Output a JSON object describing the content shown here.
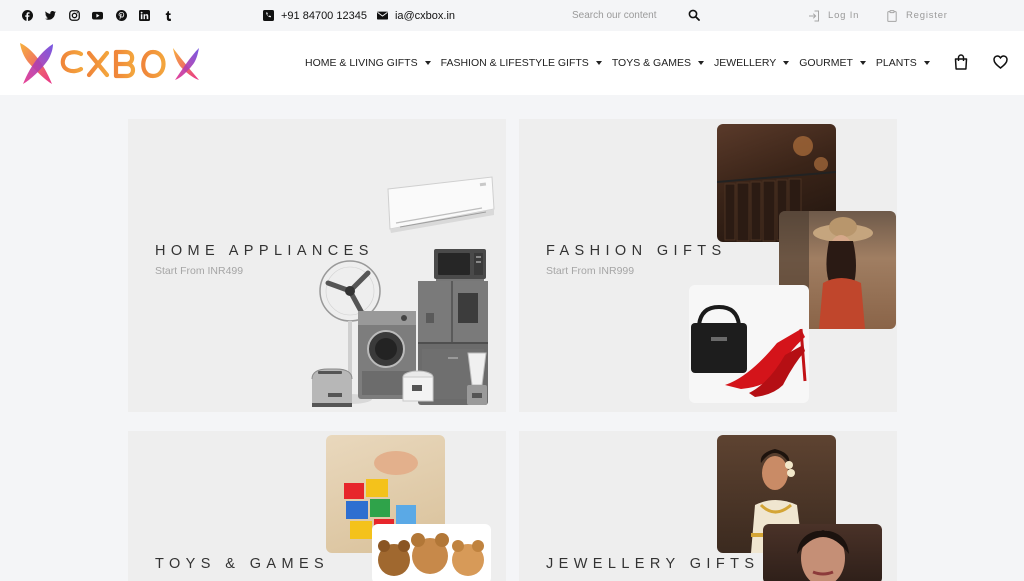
{
  "topbar": {
    "social_icons": [
      "facebook-icon",
      "twitter-icon",
      "instagram-icon",
      "youtube-icon",
      "pinterest-icon",
      "linkedin-icon",
      "tumblr-icon"
    ],
    "phone": "+91 84700 12345",
    "email": "ia@cxbox.in",
    "search_placeholder": "Search our content",
    "login_label": "Log In",
    "register_label": "Register"
  },
  "header": {
    "logo_text": "CXBOX",
    "nav": [
      {
        "label": "HOME & LIVING GIFTS"
      },
      {
        "label": "FASHION & LIFESTYLE GIFTS"
      },
      {
        "label": "TOYS & GAMES"
      },
      {
        "label": "JEWELLERY"
      },
      {
        "label": "GOURMET"
      },
      {
        "label": "PLANTS"
      }
    ]
  },
  "categories": [
    {
      "title": "HOME APPLIANCES",
      "subtitle": "Start From INR499"
    },
    {
      "title": "FASHION GIFTS",
      "subtitle": "Start From INR999"
    },
    {
      "title": "TOYS & GAMES",
      "subtitle": ""
    },
    {
      "title": "JEWELLERY GIFTS",
      "subtitle": ""
    }
  ],
  "colors": {
    "page_bg": "#f4f5f7",
    "card_bg": "#eeeeee",
    "logo_orange": "#f0863a",
    "logo_purple": "#7b3fd0",
    "logo_pink": "#e8338a"
  }
}
